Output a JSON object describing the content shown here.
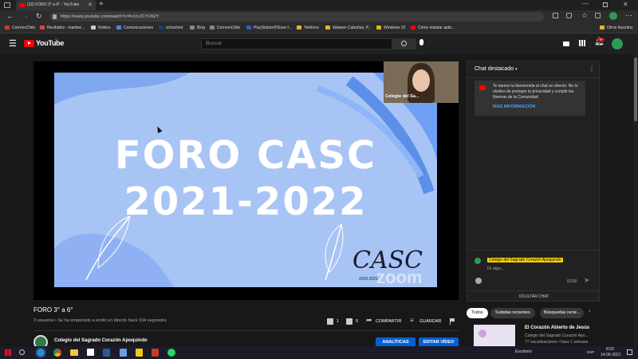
{
  "browser": {
    "tab_title": "(10) FORO 3° a 6° - YouTube",
    "url": "https://www.youtube.com/watch?v=KcVcJCYO62Y",
    "bookmarks": [
      "CorreosChile",
      "Recibidos - martine...",
      "Roblox",
      "Comunicaciones",
      "schoolnet",
      "Bing",
      "CorreosChile",
      "PlayStation®Store f...",
      "Teléfono",
      "Waiwen Cabañas, P...",
      "Windows 10",
      "Cómo instalar aplic..."
    ],
    "other_favorites": "Otros favoritos"
  },
  "youtube": {
    "logo_text": "YouTube",
    "logo_region": "CL",
    "search_placeholder": "Buscar",
    "notification_count": "9+"
  },
  "slide": {
    "line1": "FORO CASC",
    "line2": "2021-2022",
    "logo": "CASC",
    "logo_years": "2020-2021",
    "watermark": "zoom"
  },
  "camera": {
    "label": "Colegio del Sa..."
  },
  "video": {
    "title": "FORO 3° a 6°",
    "meta": "3 usuarios • Se ha empezado a emitir en directo hace 104 segundos",
    "likes": "1",
    "dislikes": "0",
    "share": "COMPARTIR",
    "save": "GUARDAR",
    "channel": "Colegio del Sagrado Corazón Apoquindo",
    "analytics": "ANALÍTICAS",
    "edit": "EDITAR VÍDEO"
  },
  "chat": {
    "header": "Chat destacado",
    "welcome": "Te damos la bienvenida al chat en directo. No te olvides de proteger tu privacidad y cumplir las Normas de la Comunidad.",
    "more_info": "MÁS INFORMACIÓN",
    "user": "Colegio del Sagrado Corazón Apoquindo",
    "input_placeholder": "Di algo...",
    "counter": "0/200",
    "hide": "OCULTAR CHAT"
  },
  "chips": [
    "Todos",
    "Subidas recientes",
    "Búsquedas recie..."
  ],
  "recommendation": {
    "title": "El Corazón Abierto de Jesús",
    "channel": "Colegio del Sagrado Corazón Apo...",
    "stats": "77 visualizaciones • hace 1 semana"
  },
  "taskbar": {
    "desktop": "Escritorio",
    "lang": "ESP",
    "time": "8:03",
    "date": "14-06-2021"
  },
  "colors": {
    "yt_red": "#ff0000",
    "accent_blue": "#3ea6ff",
    "slide_bg": "#a8c4f4",
    "analytics_btn": "#065fd4"
  }
}
